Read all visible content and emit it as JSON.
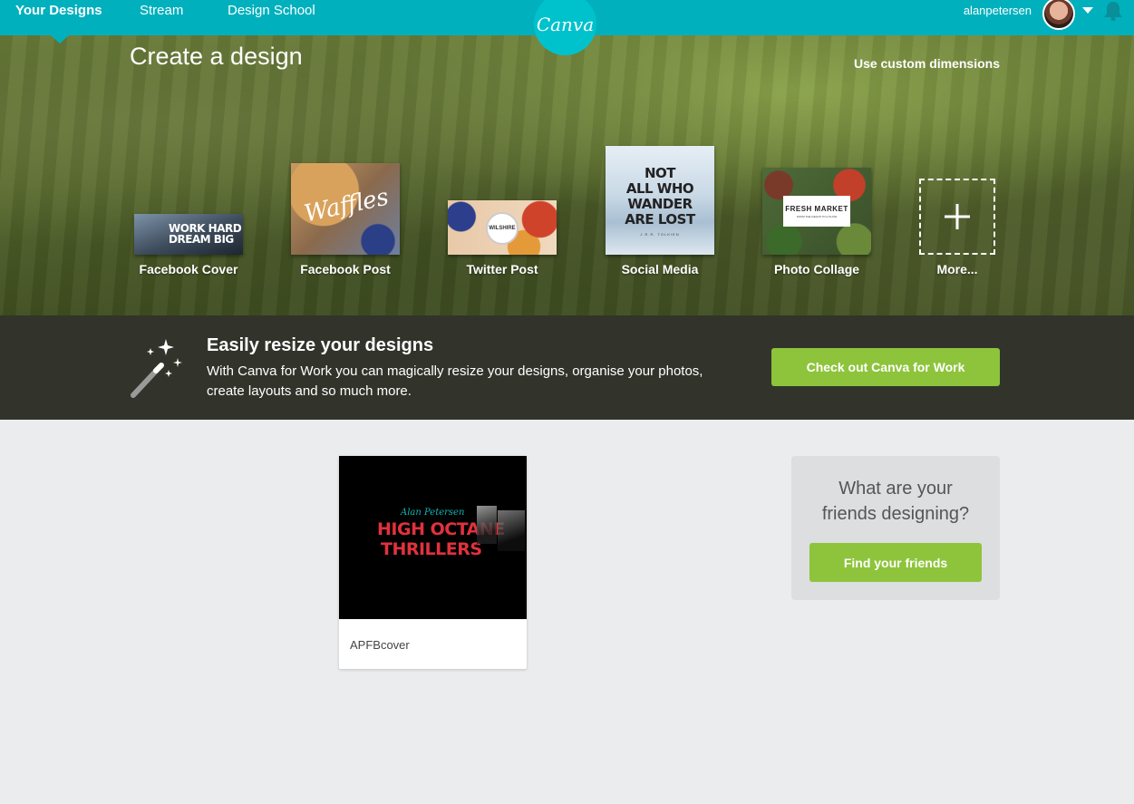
{
  "nav": {
    "tabs": [
      {
        "label": "Your Designs",
        "active": true
      },
      {
        "label": "Stream",
        "active": false
      },
      {
        "label": "Design School",
        "active": false
      }
    ],
    "logo_text": "Canva",
    "username": "alanpetersen"
  },
  "hero": {
    "title": "Create a design",
    "custom_dimensions": "Use custom dimensions",
    "templates": [
      {
        "label": "Facebook Cover",
        "thumb_text": "WORK HARD\nDREAM BIG"
      },
      {
        "label": "Facebook Post",
        "thumb_text": "Waffles"
      },
      {
        "label": "Twitter Post",
        "thumb_text": "WILSHIRE"
      },
      {
        "label": "Social Media",
        "thumb_text": "NOT\nALL WHO\nWANDER\nARE LOST",
        "thumb_sub": "J.R.R. TOLKIEN"
      },
      {
        "label": "Photo Collage",
        "thumb_text": "FRESH MARKET",
        "thumb_sub": "FROM THE FIELDS TO A PLATE"
      },
      {
        "label": "More..."
      }
    ]
  },
  "banner": {
    "title": "Easily resize your designs",
    "text": "With Canva for Work you can magically resize your designs, organise your photos, create layouts and so much more.",
    "cta": "Check out Canva for Work"
  },
  "designs": [
    {
      "name": "APFBcover",
      "thumb": {
        "author": "Alan Petersen",
        "line1": "HIGH OCTANE",
        "line2": "THRILLERS"
      }
    }
  ],
  "friends": {
    "question": "What are your\nfriends designing?",
    "cta": "Find your friends"
  },
  "colors": {
    "brand_teal": "#00b0bd",
    "accent_green": "#8dc43b"
  }
}
